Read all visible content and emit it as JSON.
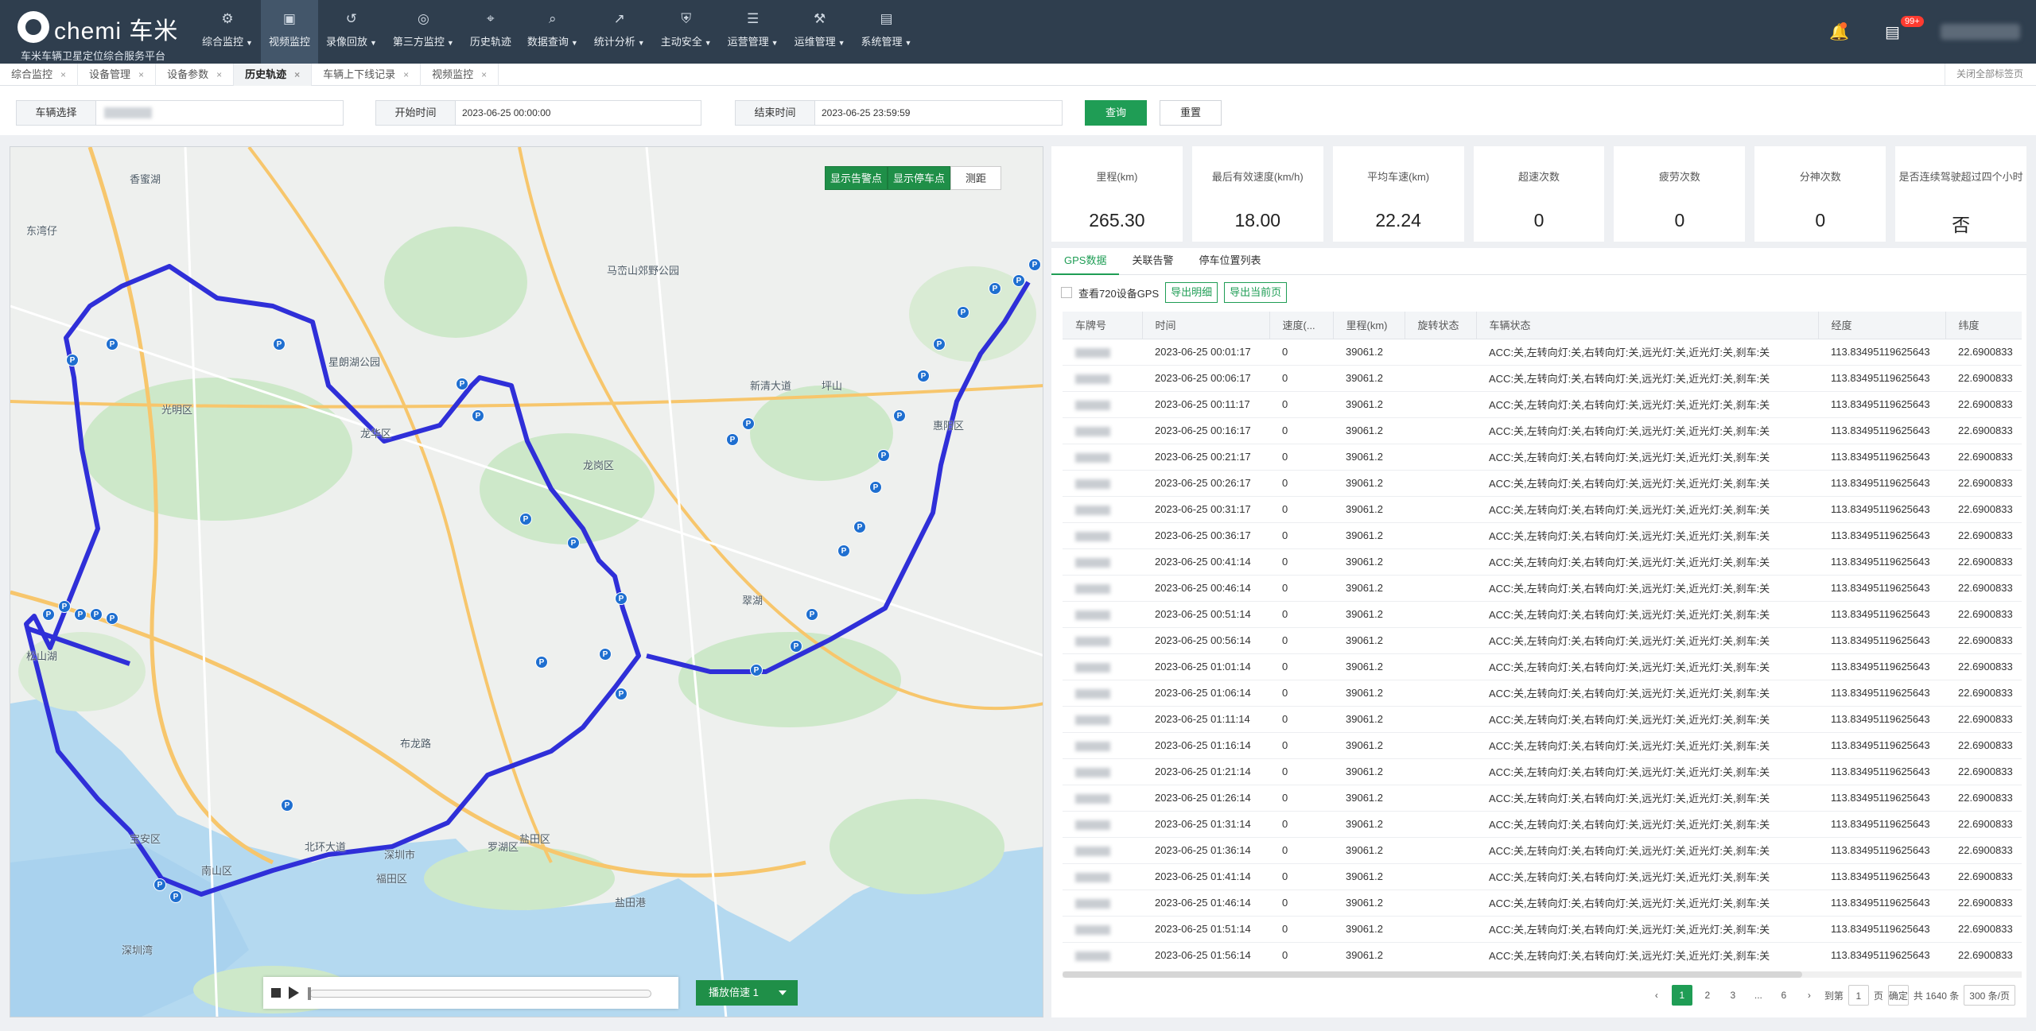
{
  "app": {
    "brand": "chemi 车米",
    "subtitle": "车米车辆卫星定位综合服务平台"
  },
  "nav": [
    {
      "label": "综合监控",
      "icon": "monitor-icon",
      "caret": true
    },
    {
      "label": "视频监控",
      "icon": "video-icon",
      "active": true
    },
    {
      "label": "录像回放",
      "icon": "replay-icon",
      "caret": true
    },
    {
      "label": "第三方监控",
      "icon": "third-party-icon",
      "caret": true
    },
    {
      "label": "历史轨迹",
      "icon": "track-icon"
    },
    {
      "label": "数据查询",
      "icon": "search-icon",
      "caret": true
    },
    {
      "label": "统计分析",
      "icon": "chart-icon",
      "caret": true
    },
    {
      "label": "主动安全",
      "icon": "shield-icon",
      "caret": true
    },
    {
      "label": "运营管理",
      "icon": "operation-icon",
      "caret": true
    },
    {
      "label": "运维管理",
      "icon": "wrench-icon",
      "caret": true
    },
    {
      "label": "系统管理",
      "icon": "system-icon",
      "caret": true
    }
  ],
  "header": {
    "notification_badge": "99+"
  },
  "tabs": [
    {
      "label": "综合监控"
    },
    {
      "label": "设备管理"
    },
    {
      "label": "设备参数"
    },
    {
      "label": "历史轨迹",
      "active": true
    },
    {
      "label": "车辆上下线记录"
    },
    {
      "label": "视频监控"
    }
  ],
  "close_all": "关闭全部标签页",
  "filters": {
    "vehicle_label": "车辆选择",
    "start_label": "开始时间",
    "start_value": "2023-06-25 00:00:00",
    "end_label": "结束时间",
    "end_value": "2023-06-25 23:59:59",
    "query": "查询",
    "reset": "重置"
  },
  "map": {
    "show_alarm": "显示告警点",
    "show_parking": "显示停车点",
    "measure": "测距",
    "speed_label": "播放倍速 1",
    "labels": [
      "香蜜湖",
      "东湾仔",
      "星朗湖公园",
      "马峦山郊野公园",
      "宝安区",
      "南山区",
      "福田区",
      "深圳市",
      "罗湖区",
      "龙岗区",
      "龙华区",
      "光明区",
      "盐田区",
      "惠阳区",
      "新清大道",
      "布龙路",
      "北环大道",
      "盐田港",
      "坪山",
      "松山湖",
      "翠湖",
      "深圳湾"
    ]
  },
  "stats": [
    {
      "label": "里程(km)",
      "value": "265.30"
    },
    {
      "label": "最后有效速度(km/h)",
      "value": "18.00"
    },
    {
      "label": "平均车速(km)",
      "value": "22.24"
    },
    {
      "label": "超速次数",
      "value": "0"
    },
    {
      "label": "疲劳次数",
      "value": "0"
    },
    {
      "label": "分神次数",
      "value": "0"
    },
    {
      "label": "是否连续驾驶超过四个小时",
      "value": "否"
    }
  ],
  "panel": {
    "tabs": [
      "GPS数据",
      "关联告警",
      "停车位置列表"
    ],
    "check_label": "查看720设备GPS",
    "export_detail": "导出明细",
    "export_page": "导出当前页",
    "columns": [
      "车牌号",
      "时间",
      "速度(...",
      "里程(km)",
      "旋转状态",
      "车辆状态",
      "经度",
      "纬度"
    ],
    "rows": [
      {
        "time": "2023-06-25 00:01:17",
        "speed": "0",
        "mileage": "39061.2",
        "status": "ACC:关,左转向灯:关,右转向灯:关,远光灯:关,近光灯:关,刹车:关",
        "lng": "113.83495119625643",
        "lat": "22.6900833"
      },
      {
        "time": "2023-06-25 00:06:17",
        "speed": "0",
        "mileage": "39061.2",
        "status": "ACC:关,左转向灯:关,右转向灯:关,远光灯:关,近光灯:关,刹车:关",
        "lng": "113.83495119625643",
        "lat": "22.6900833"
      },
      {
        "time": "2023-06-25 00:11:17",
        "speed": "0",
        "mileage": "39061.2",
        "status": "ACC:关,左转向灯:关,右转向灯:关,远光灯:关,近光灯:关,刹车:关",
        "lng": "113.83495119625643",
        "lat": "22.6900833"
      },
      {
        "time": "2023-06-25 00:16:17",
        "speed": "0",
        "mileage": "39061.2",
        "status": "ACC:关,左转向灯:关,右转向灯:关,远光灯:关,近光灯:关,刹车:关",
        "lng": "113.83495119625643",
        "lat": "22.6900833"
      },
      {
        "time": "2023-06-25 00:21:17",
        "speed": "0",
        "mileage": "39061.2",
        "status": "ACC:关,左转向灯:关,右转向灯:关,远光灯:关,近光灯:关,刹车:关",
        "lng": "113.83495119625643",
        "lat": "22.6900833"
      },
      {
        "time": "2023-06-25 00:26:17",
        "speed": "0",
        "mileage": "39061.2",
        "status": "ACC:关,左转向灯:关,右转向灯:关,远光灯:关,近光灯:关,刹车:关",
        "lng": "113.83495119625643",
        "lat": "22.6900833"
      },
      {
        "time": "2023-06-25 00:31:17",
        "speed": "0",
        "mileage": "39061.2",
        "status": "ACC:关,左转向灯:关,右转向灯:关,远光灯:关,近光灯:关,刹车:关",
        "lng": "113.83495119625643",
        "lat": "22.6900833"
      },
      {
        "time": "2023-06-25 00:36:17",
        "speed": "0",
        "mileage": "39061.2",
        "status": "ACC:关,左转向灯:关,右转向灯:关,远光灯:关,近光灯:关,刹车:关",
        "lng": "113.83495119625643",
        "lat": "22.6900833"
      },
      {
        "time": "2023-06-25 00:41:14",
        "speed": "0",
        "mileage": "39061.2",
        "status": "ACC:关,左转向灯:关,右转向灯:关,远光灯:关,近光灯:关,刹车:关",
        "lng": "113.83495119625643",
        "lat": "22.6900833"
      },
      {
        "time": "2023-06-25 00:46:14",
        "speed": "0",
        "mileage": "39061.2",
        "status": "ACC:关,左转向灯:关,右转向灯:关,远光灯:关,近光灯:关,刹车:关",
        "lng": "113.83495119625643",
        "lat": "22.6900833"
      },
      {
        "time": "2023-06-25 00:51:14",
        "speed": "0",
        "mileage": "39061.2",
        "status": "ACC:关,左转向灯:关,右转向灯:关,远光灯:关,近光灯:关,刹车:关",
        "lng": "113.83495119625643",
        "lat": "22.6900833"
      },
      {
        "time": "2023-06-25 00:56:14",
        "speed": "0",
        "mileage": "39061.2",
        "status": "ACC:关,左转向灯:关,右转向灯:关,远光灯:关,近光灯:关,刹车:关",
        "lng": "113.83495119625643",
        "lat": "22.6900833"
      },
      {
        "time": "2023-06-25 01:01:14",
        "speed": "0",
        "mileage": "39061.2",
        "status": "ACC:关,左转向灯:关,右转向灯:关,远光灯:关,近光灯:关,刹车:关",
        "lng": "113.83495119625643",
        "lat": "22.6900833"
      },
      {
        "time": "2023-06-25 01:06:14",
        "speed": "0",
        "mileage": "39061.2",
        "status": "ACC:关,左转向灯:关,右转向灯:关,远光灯:关,近光灯:关,刹车:关",
        "lng": "113.83495119625643",
        "lat": "22.6900833"
      },
      {
        "time": "2023-06-25 01:11:14",
        "speed": "0",
        "mileage": "39061.2",
        "status": "ACC:关,左转向灯:关,右转向灯:关,远光灯:关,近光灯:关,刹车:关",
        "lng": "113.83495119625643",
        "lat": "22.6900833"
      },
      {
        "time": "2023-06-25 01:16:14",
        "speed": "0",
        "mileage": "39061.2",
        "status": "ACC:关,左转向灯:关,右转向灯:关,远光灯:关,近光灯:关,刹车:关",
        "lng": "113.83495119625643",
        "lat": "22.6900833"
      },
      {
        "time": "2023-06-25 01:21:14",
        "speed": "0",
        "mileage": "39061.2",
        "status": "ACC:关,左转向灯:关,右转向灯:关,远光灯:关,近光灯:关,刹车:关",
        "lng": "113.83495119625643",
        "lat": "22.6900833"
      },
      {
        "time": "2023-06-25 01:26:14",
        "speed": "0",
        "mileage": "39061.2",
        "status": "ACC:关,左转向灯:关,右转向灯:关,远光灯:关,近光灯:关,刹车:关",
        "lng": "113.83495119625643",
        "lat": "22.6900833"
      },
      {
        "time": "2023-06-25 01:31:14",
        "speed": "0",
        "mileage": "39061.2",
        "status": "ACC:关,左转向灯:关,右转向灯:关,远光灯:关,近光灯:关,刹车:关",
        "lng": "113.83495119625643",
        "lat": "22.6900833"
      },
      {
        "time": "2023-06-25 01:36:14",
        "speed": "0",
        "mileage": "39061.2",
        "status": "ACC:关,左转向灯:关,右转向灯:关,远光灯:关,近光灯:关,刹车:关",
        "lng": "113.83495119625643",
        "lat": "22.6900833"
      },
      {
        "time": "2023-06-25 01:41:14",
        "speed": "0",
        "mileage": "39061.2",
        "status": "ACC:关,左转向灯:关,右转向灯:关,远光灯:关,近光灯:关,刹车:关",
        "lng": "113.83495119625643",
        "lat": "22.6900833"
      },
      {
        "time": "2023-06-25 01:46:14",
        "speed": "0",
        "mileage": "39061.2",
        "status": "ACC:关,左转向灯:关,右转向灯:关,远光灯:关,近光灯:关,刹车:关",
        "lng": "113.83495119625643",
        "lat": "22.6900833"
      },
      {
        "time": "2023-06-25 01:51:14",
        "speed": "0",
        "mileage": "39061.2",
        "status": "ACC:关,左转向灯:关,右转向灯:关,远光灯:关,近光灯:关,刹车:关",
        "lng": "113.83495119625643",
        "lat": "22.6900833"
      },
      {
        "time": "2023-06-25 01:56:14",
        "speed": "0",
        "mileage": "39061.2",
        "status": "ACC:关,左转向灯:关,右转向灯:关,远光灯:关,近光灯:关,刹车:关",
        "lng": "113.83495119625643",
        "lat": "22.6900833"
      }
    ]
  },
  "pager": {
    "pages": [
      "1",
      "2",
      "3",
      "...",
      "6"
    ],
    "goto_label": "到第",
    "goto_value": "1",
    "page_unit": "页",
    "confirm": "确定",
    "total": "共 1640 条",
    "page_size": "300 条/页"
  },
  "colors": {
    "accent": "#1f9d55",
    "topbar": "#2f3e4e",
    "route": "#2f2fd8"
  }
}
